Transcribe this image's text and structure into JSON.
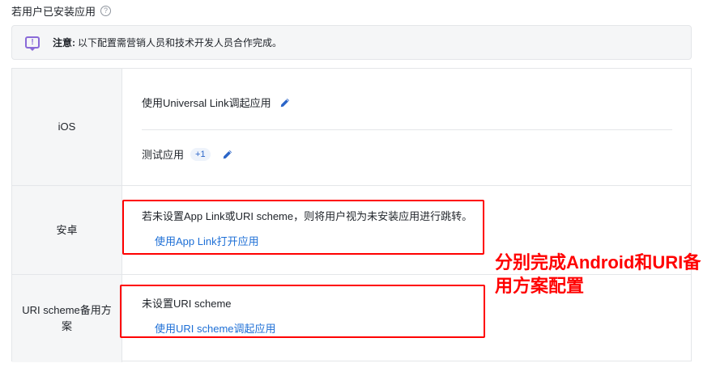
{
  "section": {
    "title": "若用户已安装应用",
    "help_icon": "question-circle-icon"
  },
  "notice": {
    "icon": "message-alert-icon",
    "label": "注意:",
    "text": "以下配置需营销人员和技术开发人员合作完成。"
  },
  "rows": {
    "ios": {
      "label": "iOS",
      "universal_link": "使用Universal Link调起应用",
      "test_app": "测试应用",
      "test_app_badge": "+1"
    },
    "android": {
      "label": "安卓",
      "description": "若未设置App Link或URI scheme，则将用户视为未安装应用进行跳转。",
      "link": "使用App Link打开应用"
    },
    "uri": {
      "label": "URI scheme备用方案",
      "description": "未设置URI scheme",
      "link": "使用URI scheme调起应用"
    }
  },
  "annotation": {
    "text": "分别完成Android和URI备用方案配置",
    "color": "#ff0000"
  },
  "colors": {
    "link": "#1d6fd6",
    "accent_purple": "#8a6ad8",
    "highlight_red": "#ff0000"
  }
}
